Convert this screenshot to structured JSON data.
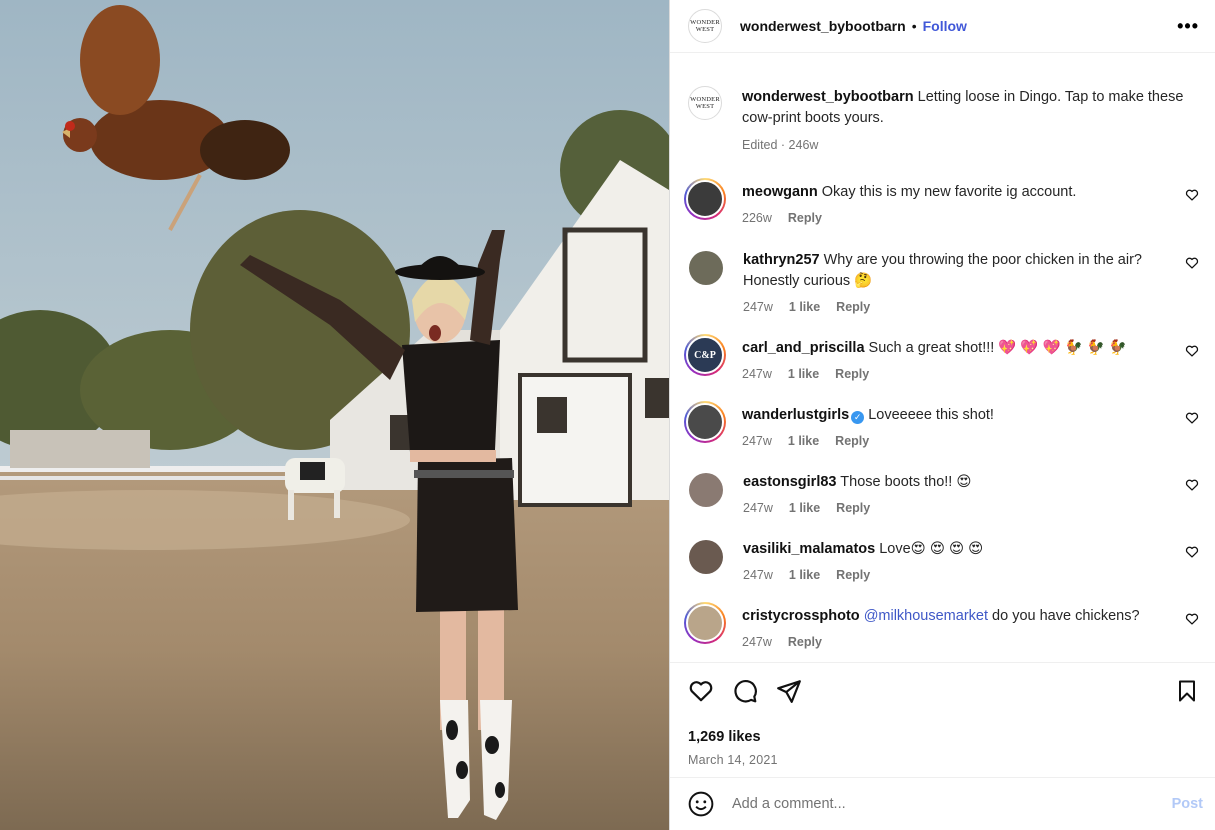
{
  "post": {
    "username": "wonderwest_bybootbarn",
    "follow_label": "Follow",
    "separator": "•",
    "more_label": "•••",
    "logo_line1": "WONDER",
    "logo_line2": "WEST",
    "caption": {
      "username": "wonderwest_bybootbarn",
      "text": "Letting loose in Dingo. Tap to make these cow-print boots yours.",
      "meta": "Edited · 246w"
    },
    "likes": "1,269 likes",
    "date": "March 14, 2021"
  },
  "comments": [
    {
      "user": "meowgann",
      "text": "Okay this is my new favorite ig account.",
      "age": "226w",
      "likes": "",
      "reply": "Reply",
      "ring": true,
      "avatar_color": "#3b3b3b"
    },
    {
      "user": "kathryn257",
      "text": "Why are you throwing the poor chicken in the air? Honestly curious 🤔",
      "age": "247w",
      "likes": "1 like",
      "reply": "Reply",
      "ring": false,
      "avatar_color": "#6d6b5a"
    },
    {
      "user": "carl_and_priscilla",
      "text": "Such a great shot!!! 💖 💖 💖 🐓 🐓 🐓",
      "age": "247w",
      "likes": "1 like",
      "reply": "Reply",
      "ring": true,
      "avatar_color": "#2b3a55",
      "avatar_text": "C&P"
    },
    {
      "user": "wanderlustgirls",
      "text": "Loveeeee this shot!",
      "age": "247w",
      "likes": "1 like",
      "reply": "Reply",
      "ring": true,
      "verified": true,
      "avatar_color": "#4a4a4a"
    },
    {
      "user": "eastonsgirl83",
      "text": "Those boots tho!! 😍",
      "age": "247w",
      "likes": "1 like",
      "reply": "Reply",
      "ring": false,
      "avatar_color": "#8a7a72"
    },
    {
      "user": "vasiliki_malamatos",
      "text": "Love😍 😍 😍 😍",
      "age": "247w",
      "likes": "1 like",
      "reply": "Reply",
      "ring": false,
      "avatar_color": "#6a5a50"
    },
    {
      "user": "cristycrossphoto",
      "mention": "@milkhousemarket",
      "text": "do you have chickens?",
      "age": "247w",
      "likes": "",
      "reply": "Reply",
      "ring": true,
      "avatar_color": "#b9a58a"
    }
  ],
  "add_comment": {
    "placeholder": "Add a comment...",
    "post_label": "Post"
  },
  "icons": {
    "like": "heart-icon",
    "comment": "comment-icon",
    "share": "share-icon",
    "save": "bookmark-icon",
    "emoji": "emoji-icon"
  },
  "colors": {
    "link": "#4158d8",
    "post_disabled": "#b2c9f7",
    "muted": "#737373"
  }
}
